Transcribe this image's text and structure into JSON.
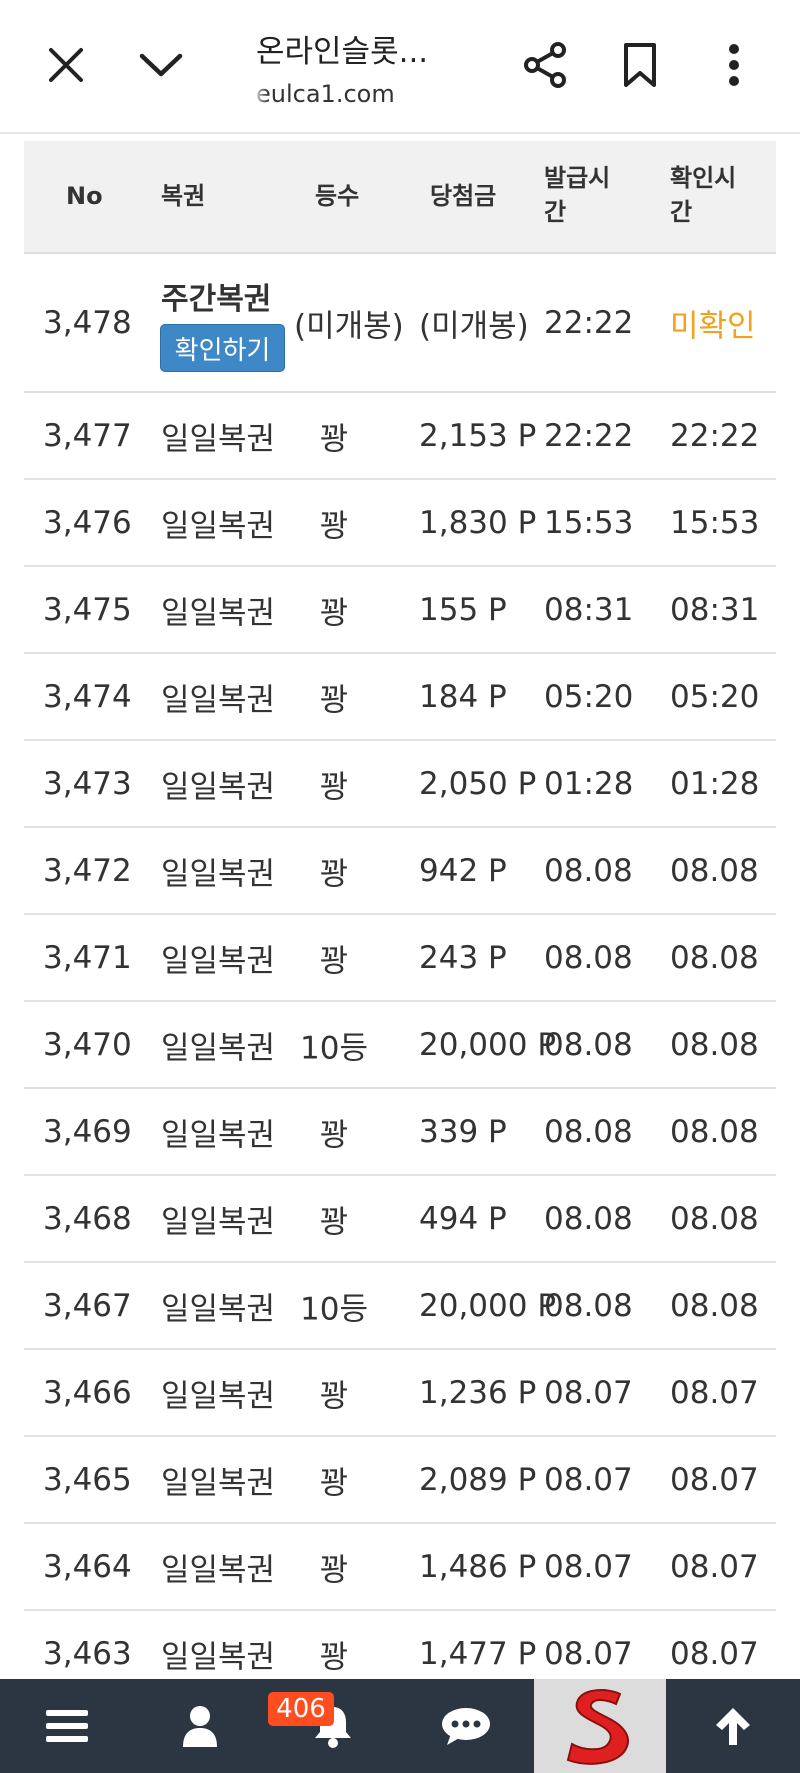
{
  "browser": {
    "title": "온라인슬롯...",
    "url": "eulca1.com",
    "icons": [
      "close-icon",
      "chevron-down-icon",
      "share-icon",
      "bookmark-icon",
      "more-vertical-icon"
    ]
  },
  "table": {
    "headers": {
      "no": "No",
      "type": "복권",
      "rank": "등수",
      "prize": "당첨금",
      "issued_line1": "발급시",
      "issued_line2": "간",
      "checked_line1": "확인시",
      "checked_line2": "간"
    },
    "first_row": {
      "no": "3,478",
      "type": "주간복권",
      "button": "확인하기",
      "rank": "(미개봉)",
      "prize": "(미개봉)",
      "issued": "22:22",
      "checked": "미확인"
    },
    "rows": [
      {
        "no": "3,477",
        "type": "일일복권",
        "rank": "꽝",
        "prize": "2,153 P",
        "issued": "22:22",
        "checked": "22:22"
      },
      {
        "no": "3,476",
        "type": "일일복권",
        "rank": "꽝",
        "prize": "1,830 P",
        "issued": "15:53",
        "checked": "15:53"
      },
      {
        "no": "3,475",
        "type": "일일복권",
        "rank": "꽝",
        "prize": "155 P",
        "issued": "08:31",
        "checked": "08:31"
      },
      {
        "no": "3,474",
        "type": "일일복권",
        "rank": "꽝",
        "prize": "184 P",
        "issued": "05:20",
        "checked": "05:20"
      },
      {
        "no": "3,473",
        "type": "일일복권",
        "rank": "꽝",
        "prize": "2,050 P",
        "issued": "01:28",
        "checked": "01:28"
      },
      {
        "no": "3,472",
        "type": "일일복권",
        "rank": "꽝",
        "prize": "942 P",
        "issued": "08.08",
        "checked": "08.08"
      },
      {
        "no": "3,471",
        "type": "일일복권",
        "rank": "꽝",
        "prize": "243 P",
        "issued": "08.08",
        "checked": "08.08"
      },
      {
        "no": "3,470",
        "type": "일일복권",
        "rank": "10등",
        "prize": "20,000 P",
        "issued": "08.08",
        "checked": "08.08"
      },
      {
        "no": "3,469",
        "type": "일일복권",
        "rank": "꽝",
        "prize": "339 P",
        "issued": "08.08",
        "checked": "08.08"
      },
      {
        "no": "3,468",
        "type": "일일복권",
        "rank": "꽝",
        "prize": "494 P",
        "issued": "08.08",
        "checked": "08.08"
      },
      {
        "no": "3,467",
        "type": "일일복권",
        "rank": "10등",
        "prize": "20,000 P",
        "issued": "08.08",
        "checked": "08.08"
      },
      {
        "no": "3,466",
        "type": "일일복권",
        "rank": "꽝",
        "prize": "1,236 P",
        "issued": "08.07",
        "checked": "08.07"
      },
      {
        "no": "3,465",
        "type": "일일복권",
        "rank": "꽝",
        "prize": "2,089 P",
        "issued": "08.07",
        "checked": "08.07"
      },
      {
        "no": "3,464",
        "type": "일일복권",
        "rank": "꽝",
        "prize": "1,486 P",
        "issued": "08.07",
        "checked": "08.07"
      },
      {
        "no": "3,463",
        "type": "일일복권",
        "rank": "꽝",
        "prize": "1,477 P",
        "issued": "08.07",
        "checked": "08.07"
      }
    ]
  },
  "bottom_nav": {
    "badge_count": "406",
    "icons": [
      "menu-icon",
      "user-icon",
      "bell-icon",
      "chat-icon",
      "site-logo",
      "arrow-up-icon"
    ]
  },
  "colors": {
    "confirm_button": "#3f88c8",
    "unconfirmed_text": "#f0a21c",
    "nav_background": "#2b3642",
    "badge": "#ff4d1f"
  }
}
